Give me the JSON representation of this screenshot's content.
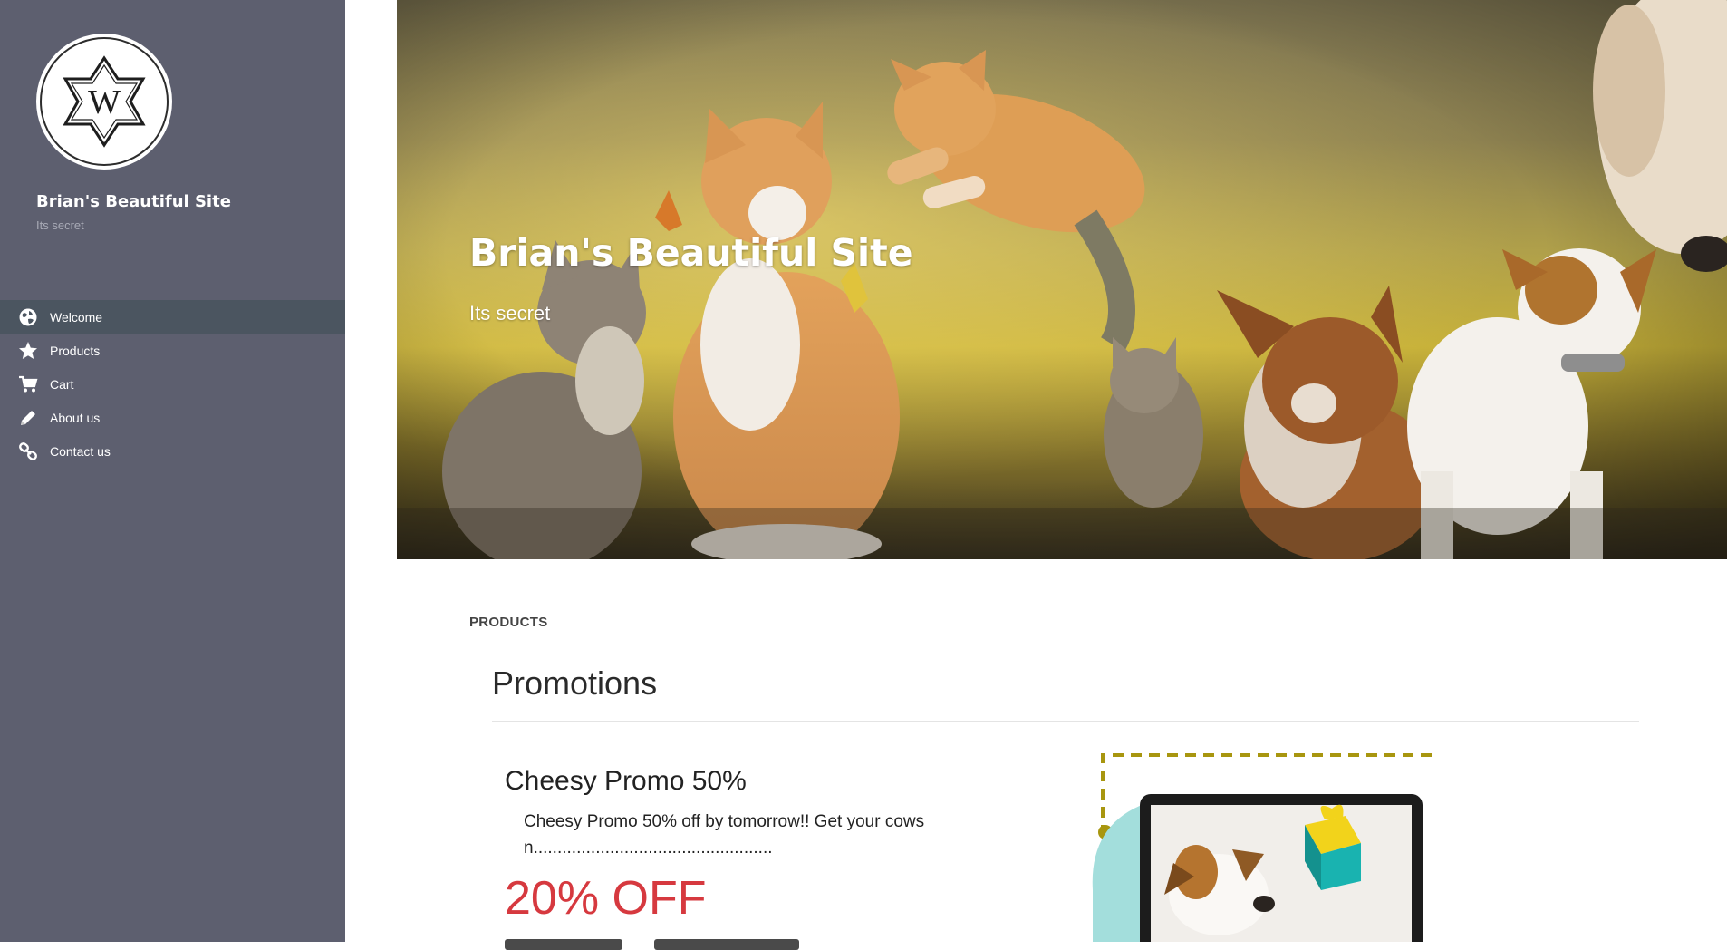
{
  "sidebar": {
    "logo_letter": "W",
    "site_name": "Brian's Beautiful Site",
    "tagline": "Its secret",
    "items": [
      {
        "label": "Welcome",
        "icon": "globe-icon",
        "active": true
      },
      {
        "label": "Products",
        "icon": "star-icon",
        "active": false
      },
      {
        "label": "Cart",
        "icon": "cart-icon",
        "active": false
      },
      {
        "label": "About us",
        "icon": "pencil-icon",
        "active": false
      },
      {
        "label": "Contact us",
        "icon": "link-icon",
        "active": false
      }
    ]
  },
  "hero": {
    "title": "Brian's Beautiful Site",
    "subtitle": "Its secret"
  },
  "content": {
    "section_label": "PRODUCTS",
    "promotions_heading": "Promotions",
    "promo": {
      "title": "Cheesy Promo 50%",
      "description": "Cheesy Promo 50% off by tomorrow!! Get your cows n..................................................",
      "discount": "20% OFF"
    }
  },
  "colors": {
    "sidebar_bg": "#5d5f6f",
    "sidebar_active": "#4b5560",
    "discount_red": "#d6393f",
    "dashed_line": "#a8960f"
  }
}
